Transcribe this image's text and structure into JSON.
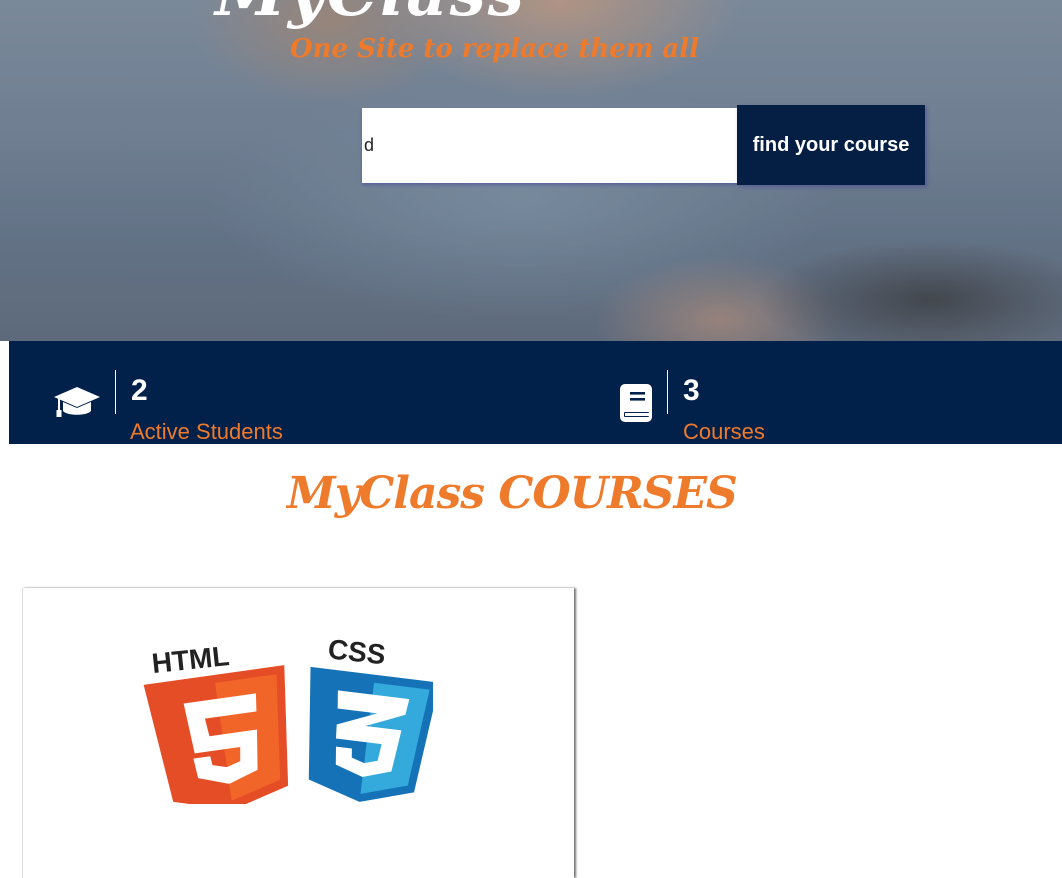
{
  "hero": {
    "title": "MyClass",
    "tagline": "One Site to replace them all"
  },
  "search": {
    "value": "d",
    "button_label": "find your course"
  },
  "stats": [
    {
      "icon": "graduation-cap-icon",
      "value": "2",
      "label": "Active Students"
    },
    {
      "icon": "book-icon",
      "value": "3",
      "label": "Courses"
    }
  ],
  "courses_section": {
    "title": "MyClass COURSES"
  },
  "courses": [
    {
      "logo": "html5-css3-logo",
      "logo_text": [
        "HTML",
        "CSS"
      ]
    }
  ],
  "colors": {
    "accent": "#ee7a2b",
    "navy": "#02214a",
    "button": "#041e44"
  }
}
